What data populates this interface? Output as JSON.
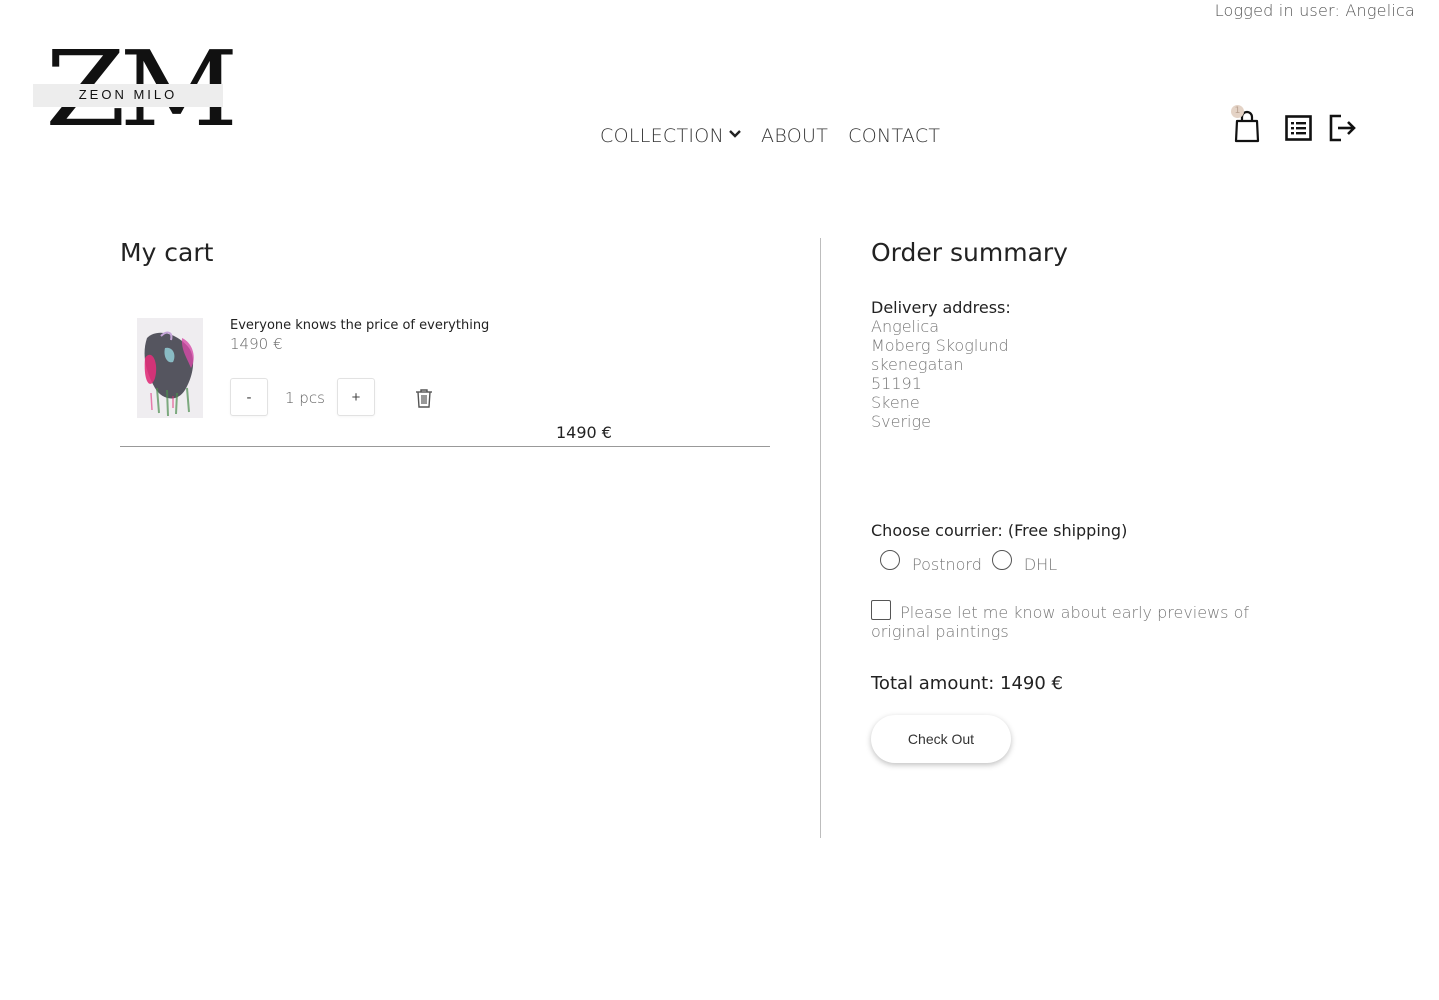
{
  "header": {
    "logged_in_text": "Logged in user: Angelica",
    "logo": {
      "letters": "ZM",
      "name": "ZEON MILO"
    },
    "nav": {
      "collection": "COLLECTION",
      "about": "ABOUT",
      "contact": "CONTACT"
    },
    "icons": {
      "cart": "shopping-bag-icon",
      "cart_badge": "1",
      "orders": "list-icon",
      "logout": "logout-icon"
    }
  },
  "cart": {
    "title": "My cart",
    "items": [
      {
        "name": "Everyone knows the price of everything",
        "price": "1490 €",
        "decrement_label": "-",
        "quantity": "1 pcs",
        "increment_label": "+",
        "line_total": "1490 €"
      }
    ]
  },
  "summary": {
    "title": "Order summary",
    "delivery_label": "Delivery address:",
    "address": [
      "Angelica",
      "Moberg Skoglund",
      "skenegatan",
      "51191",
      "Skene",
      "Sverige"
    ],
    "courier_label": "Choose courrier: (Free shipping)",
    "couriers": [
      "Postnord",
      "DHL"
    ],
    "newsletter_text": "Please let me know about early previews of original paintings",
    "total_text": "Total amount: 1490 €",
    "checkout_label": "Check Out"
  }
}
